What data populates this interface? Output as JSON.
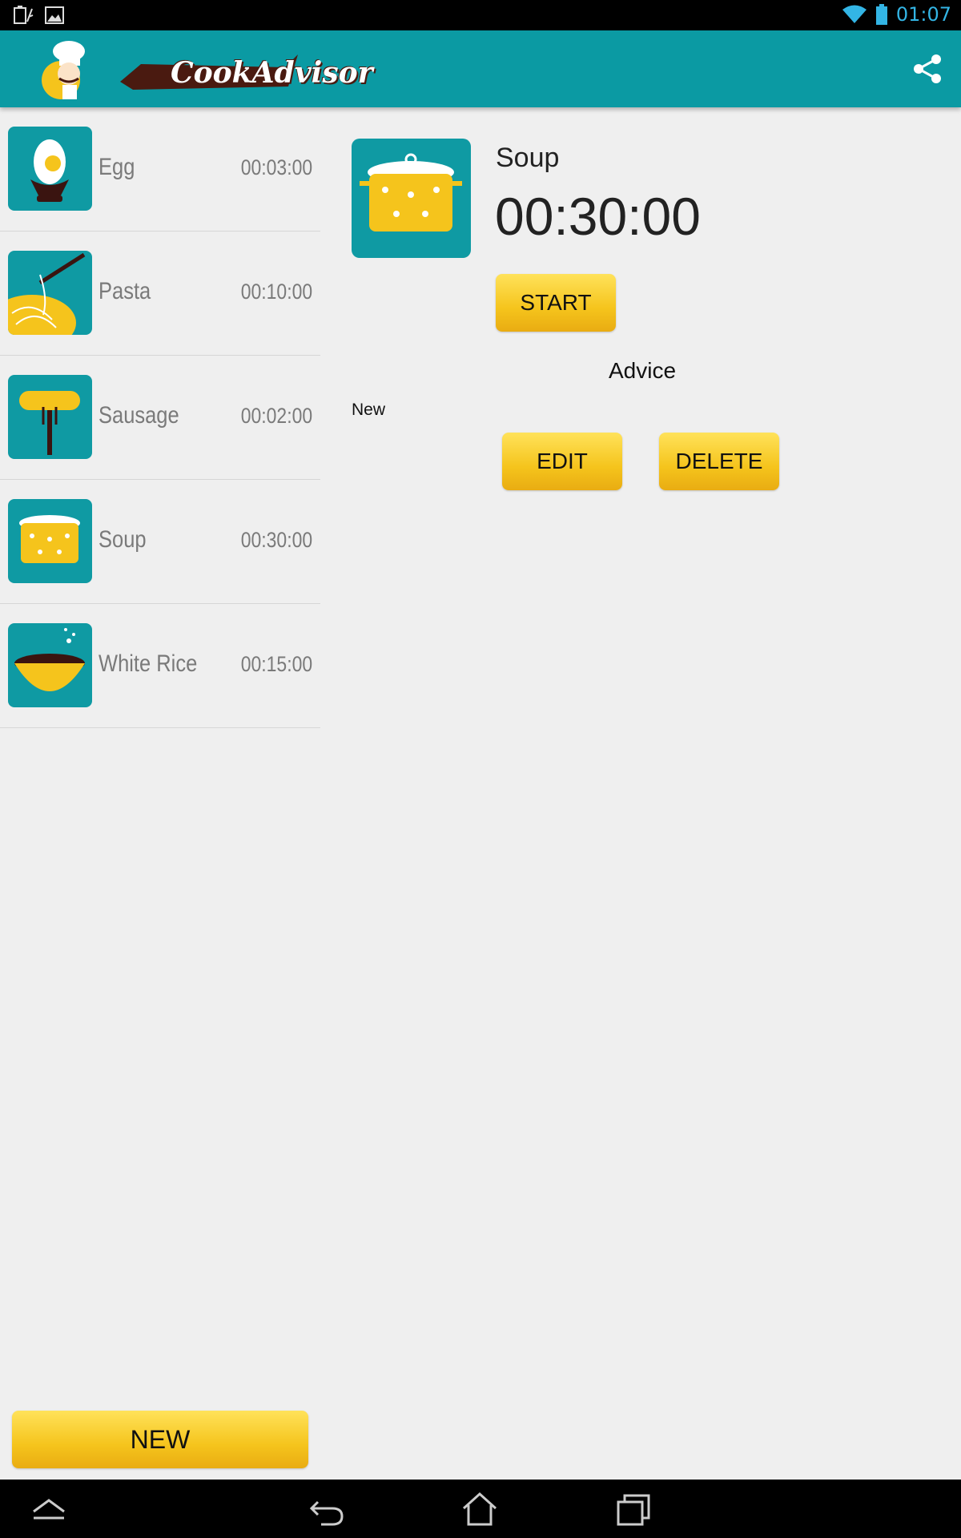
{
  "status_bar": {
    "time": "01:07",
    "icons": [
      "battery-saver-icon",
      "image-notification-icon",
      "wifi-icon",
      "battery-icon"
    ]
  },
  "action_bar": {
    "app_name": "CookAdvisor",
    "share_icon": "share-icon",
    "color": "#0b9aa3"
  },
  "list": {
    "items": [
      {
        "name": "Egg",
        "time": "00:03:00",
        "icon": "egg-icon"
      },
      {
        "name": "Pasta",
        "time": "00:10:00",
        "icon": "pasta-icon"
      },
      {
        "name": "Sausage",
        "time": "00:02:00",
        "icon": "sausage-icon"
      },
      {
        "name": "Soup",
        "time": "00:30:00",
        "icon": "soup-pot-icon"
      },
      {
        "name": "White Rice",
        "time": "00:15:00",
        "icon": "rice-bowl-icon"
      }
    ]
  },
  "detail": {
    "name": "Soup",
    "time": "00:30:00",
    "start_label": "START",
    "advice_label": "Advice",
    "advice_text": "New",
    "edit_label": "EDIT",
    "delete_label": "DELETE"
  },
  "footer": {
    "new_label": "NEW"
  },
  "nav_bar": {
    "icons": [
      "collapse-icon",
      "back-icon",
      "home-icon",
      "recent-apps-icon"
    ]
  },
  "colors": {
    "accent": "#0b9aa3",
    "button_yellow": "#f5c41c",
    "background": "#efefef"
  }
}
